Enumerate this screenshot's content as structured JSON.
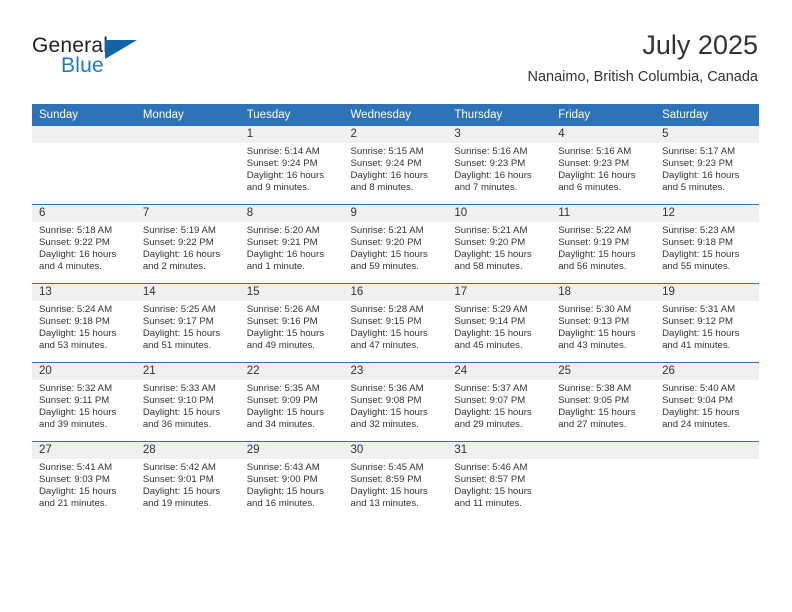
{
  "brand": {
    "word_one": "General",
    "word_two": "Blue",
    "logo_icon": "triangle-flag-icon"
  },
  "header": {
    "title": "July 2025",
    "subtitle": "Nanaimo, British Columbia, Canada"
  },
  "colors": {
    "header_blue": "#2e72b8",
    "daynum_band": "#f0f0f0",
    "brand_black": "#231f20",
    "brand_blue": "#1f7ac0",
    "text": "#333333"
  },
  "weekday_headers": [
    "Sunday",
    "Monday",
    "Tuesday",
    "Wednesday",
    "Thursday",
    "Friday",
    "Saturday"
  ],
  "weeks": [
    [
      {
        "day": "",
        "sunrise": "",
        "sunset": "",
        "daylight": ""
      },
      {
        "day": "",
        "sunrise": "",
        "sunset": "",
        "daylight": ""
      },
      {
        "day": "1",
        "sunrise": "Sunrise: 5:14 AM",
        "sunset": "Sunset: 9:24 PM",
        "daylight": "Daylight: 16 hours and 9 minutes."
      },
      {
        "day": "2",
        "sunrise": "Sunrise: 5:15 AM",
        "sunset": "Sunset: 9:24 PM",
        "daylight": "Daylight: 16 hours and 8 minutes."
      },
      {
        "day": "3",
        "sunrise": "Sunrise: 5:16 AM",
        "sunset": "Sunset: 9:23 PM",
        "daylight": "Daylight: 16 hours and 7 minutes."
      },
      {
        "day": "4",
        "sunrise": "Sunrise: 5:16 AM",
        "sunset": "Sunset: 9:23 PM",
        "daylight": "Daylight: 16 hours and 6 minutes."
      },
      {
        "day": "5",
        "sunrise": "Sunrise: 5:17 AM",
        "sunset": "Sunset: 9:23 PM",
        "daylight": "Daylight: 16 hours and 5 minutes."
      }
    ],
    [
      {
        "day": "6",
        "sunrise": "Sunrise: 5:18 AM",
        "sunset": "Sunset: 9:22 PM",
        "daylight": "Daylight: 16 hours and 4 minutes."
      },
      {
        "day": "7",
        "sunrise": "Sunrise: 5:19 AM",
        "sunset": "Sunset: 9:22 PM",
        "daylight": "Daylight: 16 hours and 2 minutes."
      },
      {
        "day": "8",
        "sunrise": "Sunrise: 5:20 AM",
        "sunset": "Sunset: 9:21 PM",
        "daylight": "Daylight: 16 hours and 1 minute."
      },
      {
        "day": "9",
        "sunrise": "Sunrise: 5:21 AM",
        "sunset": "Sunset: 9:20 PM",
        "daylight": "Daylight: 15 hours and 59 minutes."
      },
      {
        "day": "10",
        "sunrise": "Sunrise: 5:21 AM",
        "sunset": "Sunset: 9:20 PM",
        "daylight": "Daylight: 15 hours and 58 minutes."
      },
      {
        "day": "11",
        "sunrise": "Sunrise: 5:22 AM",
        "sunset": "Sunset: 9:19 PM",
        "daylight": "Daylight: 15 hours and 56 minutes."
      },
      {
        "day": "12",
        "sunrise": "Sunrise: 5:23 AM",
        "sunset": "Sunset: 9:18 PM",
        "daylight": "Daylight: 15 hours and 55 minutes."
      }
    ],
    [
      {
        "day": "13",
        "sunrise": "Sunrise: 5:24 AM",
        "sunset": "Sunset: 9:18 PM",
        "daylight": "Daylight: 15 hours and 53 minutes."
      },
      {
        "day": "14",
        "sunrise": "Sunrise: 5:25 AM",
        "sunset": "Sunset: 9:17 PM",
        "daylight": "Daylight: 15 hours and 51 minutes."
      },
      {
        "day": "15",
        "sunrise": "Sunrise: 5:26 AM",
        "sunset": "Sunset: 9:16 PM",
        "daylight": "Daylight: 15 hours and 49 minutes."
      },
      {
        "day": "16",
        "sunrise": "Sunrise: 5:28 AM",
        "sunset": "Sunset: 9:15 PM",
        "daylight": "Daylight: 15 hours and 47 minutes."
      },
      {
        "day": "17",
        "sunrise": "Sunrise: 5:29 AM",
        "sunset": "Sunset: 9:14 PM",
        "daylight": "Daylight: 15 hours and 45 minutes."
      },
      {
        "day": "18",
        "sunrise": "Sunrise: 5:30 AM",
        "sunset": "Sunset: 9:13 PM",
        "daylight": "Daylight: 15 hours and 43 minutes."
      },
      {
        "day": "19",
        "sunrise": "Sunrise: 5:31 AM",
        "sunset": "Sunset: 9:12 PM",
        "daylight": "Daylight: 15 hours and 41 minutes."
      }
    ],
    [
      {
        "day": "20",
        "sunrise": "Sunrise: 5:32 AM",
        "sunset": "Sunset: 9:11 PM",
        "daylight": "Daylight: 15 hours and 39 minutes."
      },
      {
        "day": "21",
        "sunrise": "Sunrise: 5:33 AM",
        "sunset": "Sunset: 9:10 PM",
        "daylight": "Daylight: 15 hours and 36 minutes."
      },
      {
        "day": "22",
        "sunrise": "Sunrise: 5:35 AM",
        "sunset": "Sunset: 9:09 PM",
        "daylight": "Daylight: 15 hours and 34 minutes."
      },
      {
        "day": "23",
        "sunrise": "Sunrise: 5:36 AM",
        "sunset": "Sunset: 9:08 PM",
        "daylight": "Daylight: 15 hours and 32 minutes."
      },
      {
        "day": "24",
        "sunrise": "Sunrise: 5:37 AM",
        "sunset": "Sunset: 9:07 PM",
        "daylight": "Daylight: 15 hours and 29 minutes."
      },
      {
        "day": "25",
        "sunrise": "Sunrise: 5:38 AM",
        "sunset": "Sunset: 9:05 PM",
        "daylight": "Daylight: 15 hours and 27 minutes."
      },
      {
        "day": "26",
        "sunrise": "Sunrise: 5:40 AM",
        "sunset": "Sunset: 9:04 PM",
        "daylight": "Daylight: 15 hours and 24 minutes."
      }
    ],
    [
      {
        "day": "27",
        "sunrise": "Sunrise: 5:41 AM",
        "sunset": "Sunset: 9:03 PM",
        "daylight": "Daylight: 15 hours and 21 minutes."
      },
      {
        "day": "28",
        "sunrise": "Sunrise: 5:42 AM",
        "sunset": "Sunset: 9:01 PM",
        "daylight": "Daylight: 15 hours and 19 minutes."
      },
      {
        "day": "29",
        "sunrise": "Sunrise: 5:43 AM",
        "sunset": "Sunset: 9:00 PM",
        "daylight": "Daylight: 15 hours and 16 minutes."
      },
      {
        "day": "30",
        "sunrise": "Sunrise: 5:45 AM",
        "sunset": "Sunset: 8:59 PM",
        "daylight": "Daylight: 15 hours and 13 minutes."
      },
      {
        "day": "31",
        "sunrise": "Sunrise: 5:46 AM",
        "sunset": "Sunset: 8:57 PM",
        "daylight": "Daylight: 15 hours and 11 minutes."
      },
      {
        "day": "",
        "sunrise": "",
        "sunset": "",
        "daylight": ""
      },
      {
        "day": "",
        "sunrise": "",
        "sunset": "",
        "daylight": ""
      }
    ]
  ]
}
